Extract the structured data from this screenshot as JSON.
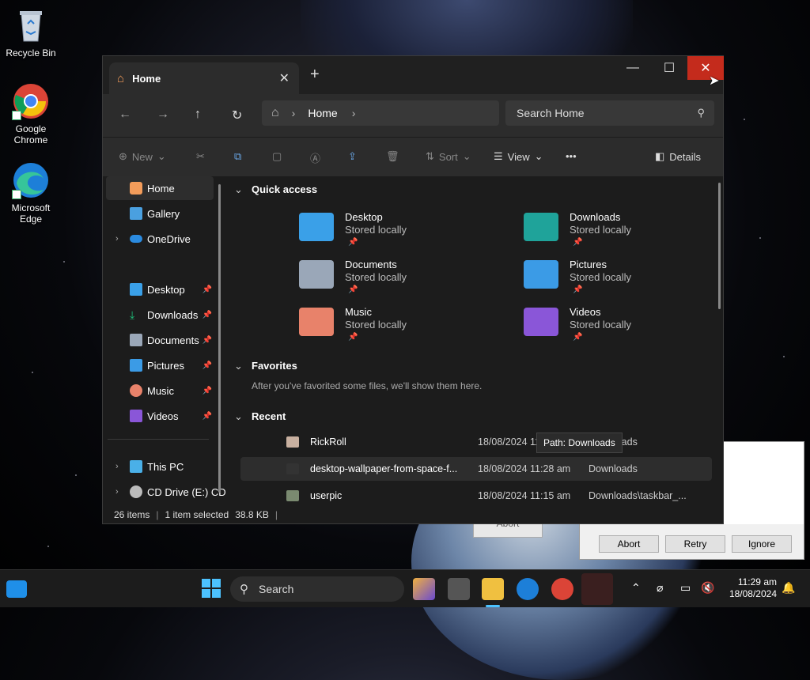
{
  "desktop": {
    "icons": [
      {
        "label": "Recycle Bin"
      },
      {
        "label": "Google Chrome"
      },
      {
        "label": "Microsoft Edge"
      }
    ]
  },
  "window": {
    "tab_title": "Home",
    "tab_close": "✕",
    "new_tab": "+",
    "minimize": "—",
    "maximize": "☐",
    "close": "✕",
    "breadcrumb": [
      "Home"
    ],
    "search_placeholder": "Search Home",
    "toolbar": {
      "new_label": "New",
      "sort_label": "Sort",
      "view_label": "View",
      "more_label": "•••",
      "details_label": "Details"
    },
    "nav": {
      "items": [
        {
          "label": "Home"
        },
        {
          "label": "Gallery"
        },
        {
          "label": "OneDrive"
        },
        {
          "label": "Desktop"
        },
        {
          "label": "Downloads"
        },
        {
          "label": "Documents"
        },
        {
          "label": "Pictures"
        },
        {
          "label": "Music"
        },
        {
          "label": "Videos"
        },
        {
          "label": "This PC"
        },
        {
          "label": "CD Drive (E:) CD"
        }
      ]
    },
    "quick_access": {
      "title": "Quick access",
      "items": [
        {
          "name": "Desktop",
          "status": "Stored locally",
          "color": "#3aa0e8"
        },
        {
          "name": "Downloads",
          "status": "Stored locally",
          "color": "#1fa39a"
        },
        {
          "name": "Documents",
          "status": "Stored locally",
          "color": "#9aa7b8"
        },
        {
          "name": "Pictures",
          "status": "Stored locally",
          "color": "#3b9be6"
        },
        {
          "name": "Music",
          "status": "Stored locally",
          "color": "#e8826a"
        },
        {
          "name": "Videos",
          "status": "Stored locally",
          "color": "#8a56d8"
        }
      ]
    },
    "favorites": {
      "title": "Favorites",
      "empty_text": "After you've favorited some files, we'll show them here."
    },
    "recent": {
      "title": "Recent",
      "rows": [
        {
          "name": "RickRoll",
          "date": "18/08/2024 11:28 am",
          "location": "Downloads"
        },
        {
          "name": "desktop-wallpaper-from-space-f...",
          "date": "18/08/2024 11:28 am",
          "location": "Downloads"
        },
        {
          "name": "userpic",
          "date": "18/08/2024 11:15 am",
          "location": "Downloads\\taskbar_..."
        }
      ],
      "tooltip": "Path: Downloads"
    },
    "status": {
      "items_count": "26 items",
      "selected": "1 item selected",
      "size": "38.8 KB"
    }
  },
  "dialog": {
    "partial_label": "Abort",
    "buttons": [
      "Abort",
      "Retry",
      "Ignore"
    ]
  },
  "taskbar": {
    "search_label": "Search",
    "time": "11:29 am",
    "date": "18/08/2024"
  }
}
